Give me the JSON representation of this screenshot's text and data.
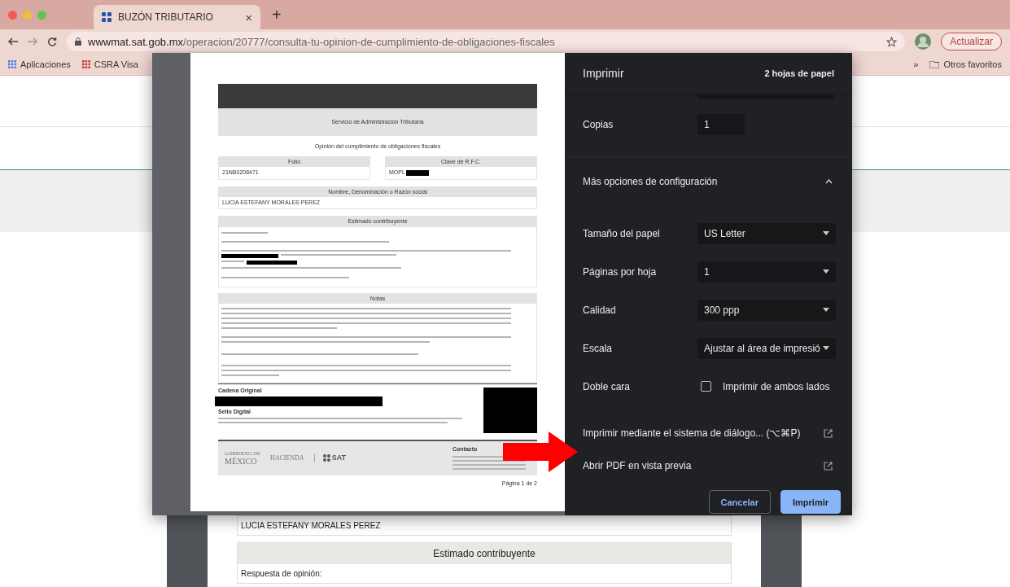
{
  "browser": {
    "tab": {
      "title": "BUZÓN TRIBUTARIO",
      "close": "×"
    },
    "new_tab": "+",
    "url": {
      "domain": "wwwmat.sat.gob.mx",
      "path": "/operacion/20777/consulta-tu-opinion-de-cumplimiento-de-obligaciones-fiscales"
    },
    "update_button": "Actualizar",
    "bookmarks": [
      "Aplicaciones",
      "CSRA Visa"
    ],
    "overflow": "»",
    "other_bookmarks": "Otros favoritos"
  },
  "preview": {
    "agency": "Servicio de Administración Tributaria",
    "title": "Opinión del cumplimiento de obligaciones fiscales",
    "folio": {
      "label": "Folio",
      "value": "21NB0208471"
    },
    "rfc": {
      "label": "Clave de R.F.C.",
      "value": "MOPL"
    },
    "name": {
      "label": "Nombre, Denominación o Razón social",
      "value": "LUCIA ESTEFANY MORALES PEREZ"
    },
    "estimado": {
      "label": "Estimado contribuyente"
    },
    "notes": {
      "label": "Notas"
    },
    "chain_label": "Cadena Original",
    "seal_label": "Sello Digital",
    "footer": {
      "gov_small": "GOBIERNO DE",
      "gov_big": "MÉXICO",
      "hacienda": "HACIENDA",
      "sat": "SAT",
      "contact_label": "Contacto"
    },
    "page": "Página 1 de 2"
  },
  "print_panel": {
    "title": "Imprimir",
    "sheets": "2 hojas de papel",
    "copies": {
      "label": "Copias",
      "value": "1"
    },
    "more_options": {
      "label": "Más opciones de configuración",
      "expanded": true
    },
    "settings": [
      {
        "kind": "select",
        "label": "Tamaño del papel",
        "value": "US Letter"
      },
      {
        "kind": "select",
        "label": "Páginas por hoja",
        "value": "1"
      },
      {
        "kind": "select",
        "label": "Calidad",
        "value": "300 ppp"
      },
      {
        "kind": "select",
        "label": "Escala",
        "value": "Ajustar al área de impresió"
      },
      {
        "kind": "checkbox",
        "label": "Doble cara",
        "value": "Imprimir de ambos lados",
        "checked": false
      }
    ],
    "links": [
      "Imprimir mediante el sistema de diálogo... (⌥⌘P)",
      "Abrir PDF en vista previa"
    ],
    "buttons": [
      {
        "kind": "secondary",
        "label": "Cancelar"
      },
      {
        "kind": "primary",
        "label": "Imprimir"
      }
    ]
  },
  "background_document": {
    "name": "LUCIA ESTEFANY MORALES PEREZ",
    "heading": "Estimado contribuyente",
    "response": "Respuesta de opinión:"
  }
}
